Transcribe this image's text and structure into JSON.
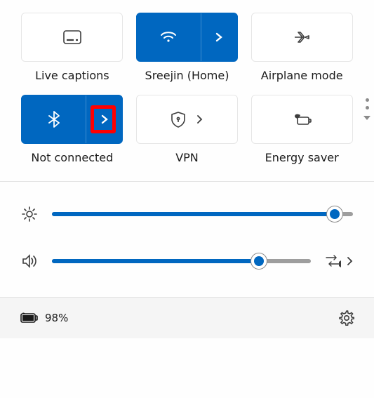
{
  "tiles": {
    "live_captions": {
      "label": "Live captions"
    },
    "wifi": {
      "label": "Sreejin (Home)"
    },
    "airplane": {
      "label": "Airplane mode"
    },
    "bluetooth": {
      "label": "Not connected"
    },
    "vpn": {
      "label": "VPN"
    },
    "energy_saver": {
      "label": "Energy saver"
    }
  },
  "sliders": {
    "brightness": {
      "percent": 94
    },
    "volume": {
      "percent": 80
    }
  },
  "footer": {
    "battery_text": "98%"
  },
  "colors": {
    "accent": "#0067c0",
    "highlight": "#ff0000"
  }
}
